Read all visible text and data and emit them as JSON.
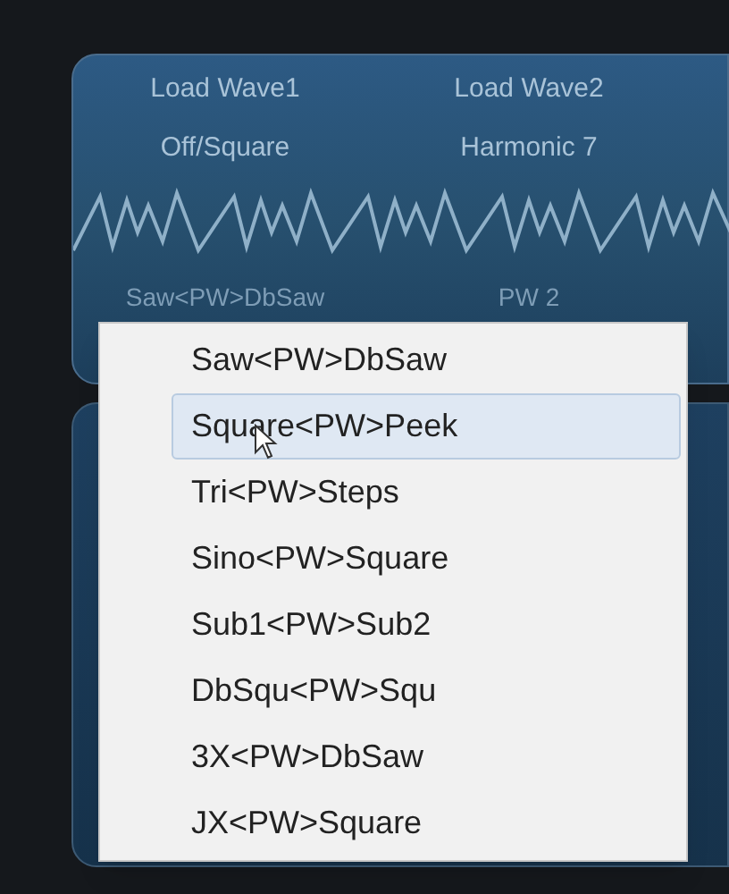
{
  "panel": {
    "slots": [
      {
        "label": "Load Wave1",
        "value": "Off/Square",
        "pw": "Saw<PW>DbSaw"
      },
      {
        "label": "Load Wave2",
        "value": "Harmonic 7",
        "pw": "PW 2"
      }
    ]
  },
  "menu": {
    "items": [
      {
        "label": "Saw<PW>DbSaw",
        "selected": false
      },
      {
        "label": "Square<PW>Peek",
        "selected": true
      },
      {
        "label": "Tri<PW>Steps",
        "selected": false
      },
      {
        "label": "Sino<PW>Square",
        "selected": false
      },
      {
        "label": "Sub1<PW>Sub2",
        "selected": false
      },
      {
        "label": "DbSqu<PW>Squ",
        "selected": false
      },
      {
        "label": "3X<PW>DbSaw",
        "selected": false
      },
      {
        "label": "JX<PW>Square",
        "selected": false
      }
    ]
  }
}
